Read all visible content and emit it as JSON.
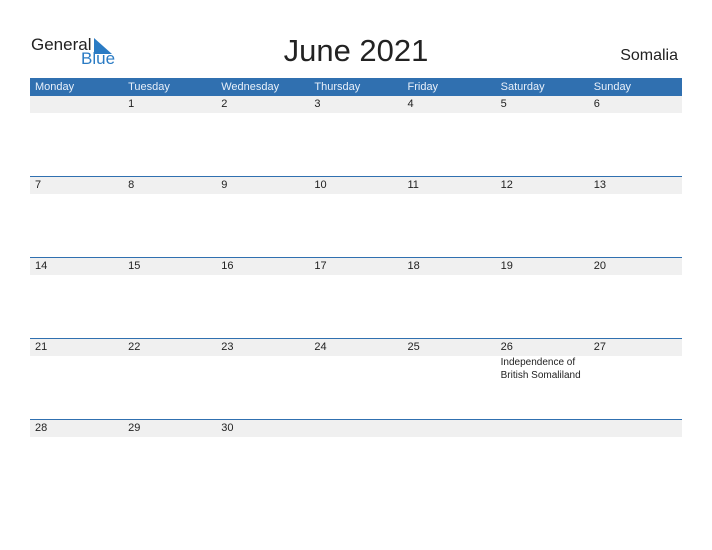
{
  "logo": {
    "text1": "General",
    "text2": "Blue"
  },
  "title": "June 2021",
  "country": "Somalia",
  "days": [
    "Monday",
    "Tuesday",
    "Wednesday",
    "Thursday",
    "Friday",
    "Saturday",
    "Sunday"
  ],
  "weeks": [
    {
      "nums": [
        "",
        "1",
        "2",
        "3",
        "4",
        "5",
        "6"
      ],
      "events": [
        "",
        "",
        "",
        "",
        "",
        "",
        ""
      ]
    },
    {
      "nums": [
        "7",
        "8",
        "9",
        "10",
        "11",
        "12",
        "13"
      ],
      "events": [
        "",
        "",
        "",
        "",
        "",
        "",
        ""
      ]
    },
    {
      "nums": [
        "14",
        "15",
        "16",
        "17",
        "18",
        "19",
        "20"
      ],
      "events": [
        "",
        "",
        "",
        "",
        "",
        "",
        ""
      ]
    },
    {
      "nums": [
        "21",
        "22",
        "23",
        "24",
        "25",
        "26",
        "27"
      ],
      "events": [
        "",
        "",
        "",
        "",
        "",
        "Independence of British Somaliland",
        ""
      ]
    },
    {
      "nums": [
        "28",
        "29",
        "30",
        "",
        "",
        "",
        ""
      ],
      "events": [
        "",
        "",
        "",
        "",
        "",
        "",
        ""
      ]
    }
  ]
}
